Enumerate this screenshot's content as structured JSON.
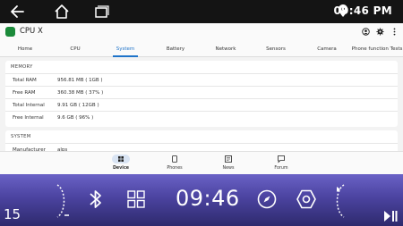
{
  "status_bar": {
    "time": "09:46 PM"
  },
  "app": {
    "title": "CPU X",
    "tabs": [
      "Home",
      "CPU",
      "System",
      "Battery",
      "Network",
      "Sensors",
      "Camera",
      "Phone function Tests"
    ],
    "active_tab": "System",
    "memory": {
      "title": "MEMORY",
      "rows": [
        {
          "label": "Total RAM",
          "value": "956.81 MB ( 1GB )"
        },
        {
          "label": "Free RAM",
          "value": "360.38 MB ( 37% )"
        },
        {
          "label": "Total Internal",
          "value": "9.91 GB ( 12GB )"
        },
        {
          "label": "Free Internal",
          "value": "9.6 GB ( 96% )"
        }
      ]
    },
    "system": {
      "title": "SYSTEM",
      "partial_row": {
        "label": "Manufacturer",
        "value": "alps"
      }
    },
    "bottom_nav": [
      {
        "label": "Device",
        "icon": "device-icon",
        "active": true
      },
      {
        "label": "Phones",
        "icon": "phones-icon",
        "active": false
      },
      {
        "label": "News",
        "icon": "news-icon",
        "active": false
      },
      {
        "label": "Forum",
        "icon": "forum-icon",
        "active": false
      }
    ]
  },
  "dock": {
    "clock": "09:46",
    "left_number": "15",
    "icons": [
      "volume-down-icon",
      "bluetooth-icon",
      "apps-grid-icon",
      "compass-icon",
      "settings-hex-icon",
      "next-track-icon",
      "play-pause-icon"
    ]
  },
  "colors": {
    "accent": "#1e73c9",
    "dock_top": "#6a62c6",
    "dock_bottom": "#2e2a6d",
    "logo": "#1b8a3a"
  }
}
